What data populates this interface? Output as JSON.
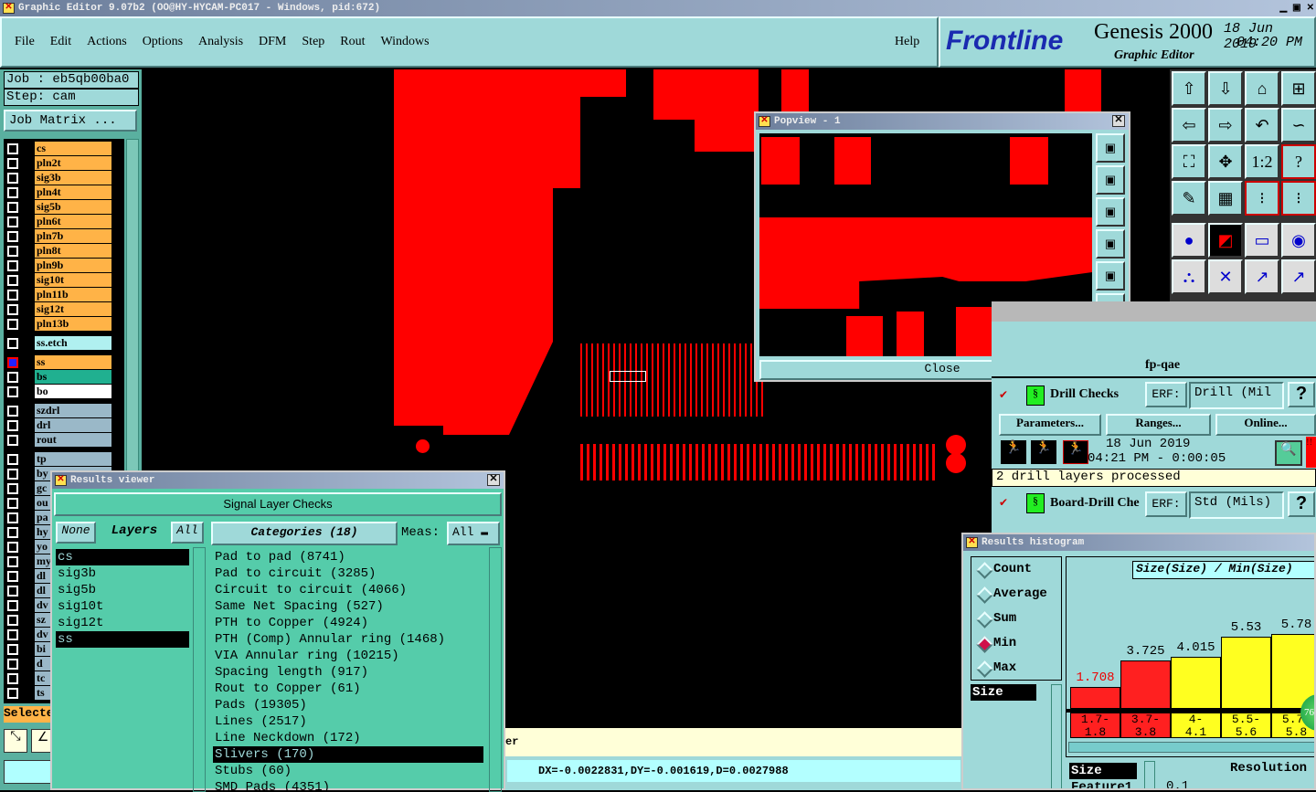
{
  "window_title": "Graphic Editor 9.07b2 (OO@HY-HYCAM-PC017 - Windows, pid:672)",
  "menu": [
    "File",
    "Edit",
    "Actions",
    "Options",
    "Analysis",
    "DFM",
    "Step",
    "Rout",
    "Windows"
  ],
  "help": "Help",
  "brand": {
    "logo": "Frontline",
    "product": "Genesis 2000",
    "subtitle": "Graphic Editor",
    "date": "18 Jun 2019",
    "time": "04:20 PM"
  },
  "job": {
    "job_label": "Job : eb5qb00ba0",
    "step_label": "Step: cam",
    "job_matrix": "Job Matrix ..."
  },
  "layers": [
    {
      "n": "cs",
      "c": "#ffb347"
    },
    {
      "n": "pln2t",
      "c": "#ffb347"
    },
    {
      "n": "sig3b",
      "c": "#ffb347"
    },
    {
      "n": "pln4t",
      "c": "#ffb347"
    },
    {
      "n": "sig5b",
      "c": "#ffb347"
    },
    {
      "n": "pln6t",
      "c": "#ffb347"
    },
    {
      "n": "pln7b",
      "c": "#ffb347"
    },
    {
      "n": "pln8t",
      "c": "#ffb347"
    },
    {
      "n": "pln9b",
      "c": "#ffb347"
    },
    {
      "n": "sig10t",
      "c": "#ffb347"
    },
    {
      "n": "pln11b",
      "c": "#ffb347"
    },
    {
      "n": "sig12t",
      "c": "#ffb347"
    },
    {
      "n": "pln13b",
      "c": "#ffb347"
    },
    {
      "n": "ss.etch",
      "c": "#b0f0f0",
      "gap": true
    },
    {
      "n": "ss",
      "c": "#ffb347",
      "gap": true,
      "active": true
    },
    {
      "n": "bs",
      "c": "#20b090"
    },
    {
      "n": "bo",
      "c": "#ffffff"
    },
    {
      "n": "szdrl",
      "c": "#9ab8c8",
      "gap": true
    },
    {
      "n": "drl",
      "c": "#9ab8c8"
    },
    {
      "n": "rout",
      "c": "#9ab8c8"
    },
    {
      "n": "tp",
      "c": "#9ab8c8",
      "gap": true
    },
    {
      "n": "by",
      "c": "#9ab8c8"
    },
    {
      "n": "gc",
      "c": "#9ab8c8"
    },
    {
      "n": "ou",
      "c": "#9ab8c8"
    },
    {
      "n": "pa",
      "c": "#9ab8c8"
    },
    {
      "n": "hy",
      "c": "#9ab8c8"
    },
    {
      "n": "yo",
      "c": "#9ab8c8"
    },
    {
      "n": "my",
      "c": "#9ab8c8"
    },
    {
      "n": "dl",
      "c": "#9ab8c8"
    },
    {
      "n": "dl",
      "c": "#9ab8c8"
    },
    {
      "n": "dv",
      "c": "#9ab8c8"
    },
    {
      "n": "sz",
      "c": "#9ab8c8"
    },
    {
      "n": "dv",
      "c": "#9ab8c8"
    },
    {
      "n": "bi",
      "c": "#9ab8c8"
    },
    {
      "n": "d",
      "c": "#9ab8c8"
    },
    {
      "n": "tc",
      "c": "#9ab8c8"
    },
    {
      "n": "ts",
      "c": "#9ab8c8"
    }
  ],
  "selected_label": "Selecte",
  "popview": {
    "title": "Popview - 1",
    "close": "Close"
  },
  "dfm": {
    "header": "fp-qae",
    "check1": {
      "name": "Drill Checks",
      "erf_label": "ERF:",
      "erf_value": "Drill (Mil",
      "help": "?",
      "params": "Parameters...",
      "ranges": "Ranges...",
      "online": "Online...",
      "date": "18 Jun 2019",
      "time": "04:21 PM - 0:00:05",
      "status": "2 drill layers processed",
      "alert": "!!"
    },
    "check2": {
      "name": "Board-Drill Che",
      "erf_label": "ERF:",
      "erf_value": "Std (Mils)",
      "help": "?"
    }
  },
  "results_viewer": {
    "title": "Results viewer",
    "header": "Signal Layer Checks",
    "none": "None",
    "layers_label": "Layers",
    "all": "All",
    "layers": [
      "cs",
      "sig3b",
      "sig5b",
      "sig10t",
      "sig12t",
      "ss"
    ],
    "selected_layers": [
      "cs",
      "ss"
    ],
    "categories_label": "Categories (18)",
    "meas_label": "Meas:",
    "meas_value": "All",
    "categories": [
      "Pad to pad (8741)",
      "Pad to circuit (3285)",
      "Circuit to circuit (4066)",
      "Same Net Spacing (527)",
      "PTH to Copper (4924)",
      "PTH (Comp) Annular ring (1468)",
      "VIA Annular ring (10215)",
      "Spacing length (917)",
      "Rout to Copper (61)",
      "Pads (19305)",
      "Lines (2517)",
      "Line Neckdown (172)",
      "Slivers (170)",
      "Stubs (60)",
      "SMD Pads (4351)"
    ],
    "selected_category": "Slivers (170)"
  },
  "histogram": {
    "title": "Results histogram",
    "modes": [
      "Count",
      "Average",
      "Sum",
      "Min",
      "Max"
    ],
    "selected_mode": "Min",
    "fields": [
      "Size"
    ],
    "chart_title": "Size(Size) / Min(Size)",
    "bins": [
      {
        "label": "1.7-\n1.8",
        "value": 1.708,
        "text": "1.708",
        "color": "#ff2020"
      },
      {
        "label": "3.7-\n3.8",
        "value": 3.725,
        "text": "3.725",
        "color": "#ff2020"
      },
      {
        "label": "4-\n4.1",
        "value": 4.015,
        "text": "4.015",
        "color": "#ffff20"
      },
      {
        "label": "5.5-\n5.6",
        "value": 5.53,
        "text": "5.53",
        "color": "#ffff20"
      },
      {
        "label": "5.7-\n5.8",
        "value": 5.78,
        "text": "5.78",
        "color": "#ffff20"
      }
    ],
    "list2": [
      "Size",
      "Feature1"
    ],
    "resolution_label": "Resolution",
    "resolution_value": "0.1",
    "badge": "76"
  },
  "status": {
    "message": "er",
    "coords": "DX=-0.0022831,DY=-0.001619,D=0.0027988"
  },
  "colors": {
    "panel": "#9fd9d9",
    "teal": "#55ccaa",
    "copper": "#ff0000"
  }
}
